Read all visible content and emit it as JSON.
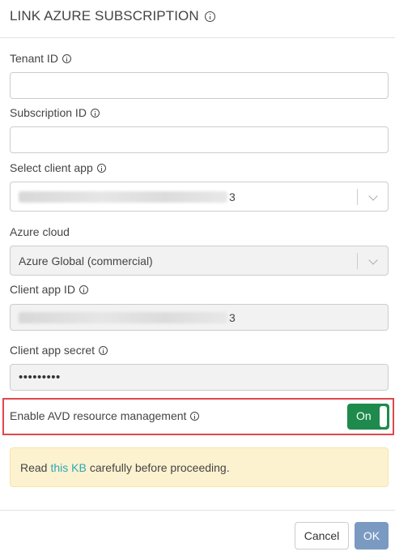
{
  "dialog": {
    "title": "LINK AZURE SUBSCRIPTION"
  },
  "fields": {
    "tenant_id": {
      "label": "Tenant ID",
      "value": ""
    },
    "subscription_id": {
      "label": "Subscription ID",
      "value": ""
    },
    "client_app": {
      "label": "Select client app",
      "value_tail": "3"
    },
    "azure_cloud": {
      "label": "Azure cloud",
      "value": "Azure Global (commercial)"
    },
    "client_app_id": {
      "label": "Client app ID",
      "value_tail": "3"
    },
    "client_app_secret": {
      "label": "Client app secret",
      "value": "•••••••••"
    }
  },
  "avd": {
    "label": "Enable AVD resource management",
    "toggle_text": "On",
    "enabled": true
  },
  "alert": {
    "prefix": "Read",
    "link_text": "this KB",
    "suffix": "carefully before proceeding."
  },
  "buttons": {
    "cancel": "Cancel",
    "ok": "OK"
  },
  "colors": {
    "toggle_on": "#1e8a4c",
    "highlight_border": "#e0474c",
    "alert_bg": "#fdf2cf",
    "link": "#2ba8b4",
    "ok_button": "#7a9ac2"
  }
}
